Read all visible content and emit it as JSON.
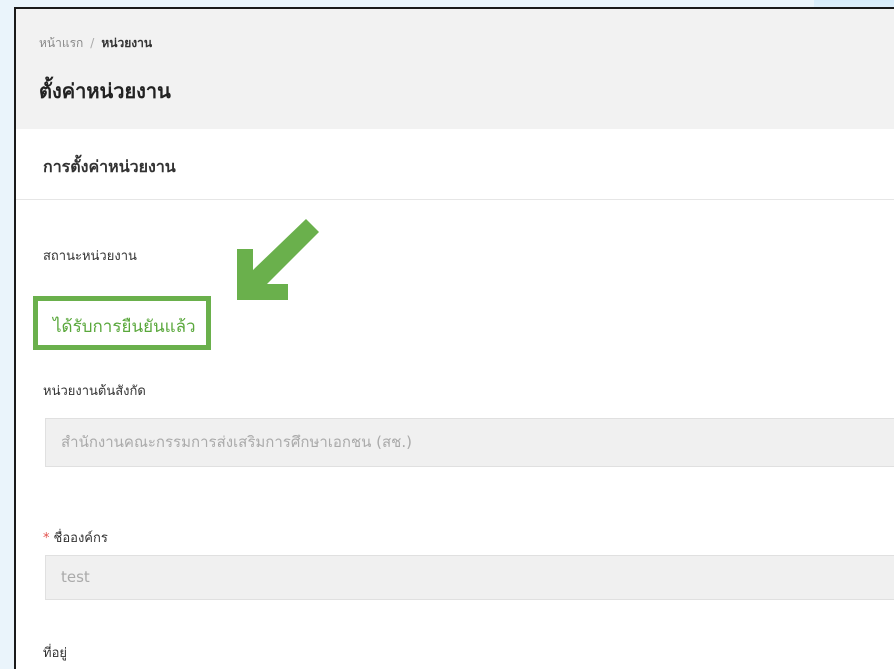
{
  "breadcrumb": {
    "home": "หน้าแรก",
    "separator": "/",
    "current": "หน่วยงาน"
  },
  "page_title": "ตั้งค่าหน่วยงาน",
  "card": {
    "title": "การตั้งค่าหน่วยงาน"
  },
  "fields": {
    "status": {
      "label": "สถานะหน่วยงาน",
      "value": "ได้รับการยืนยันแล้ว"
    },
    "parent_org": {
      "label": "หน่วยงานต้นสังกัด",
      "value": "สำนักงานคณะกรรมการส่งเสริมการศึกษาเอกชน (สช.)"
    },
    "org_name": {
      "required_mark": "*",
      "label": "ชื่อองค์กร",
      "value": "test"
    },
    "address": {
      "label": "ที่อยู่"
    }
  },
  "colors": {
    "highlight_green": "#6ab04c",
    "status_text_green": "#5aa83c",
    "required_red": "#e2504c",
    "frame_border": "#1a1a1a"
  },
  "icons": {
    "annotation_arrow": "green-arrow-down-left-icon"
  }
}
